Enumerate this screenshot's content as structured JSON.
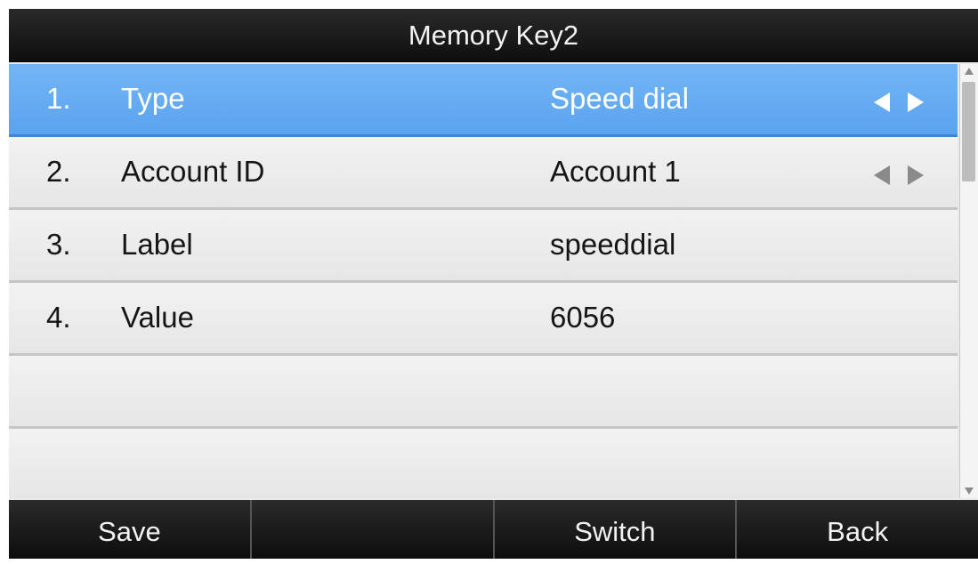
{
  "title": "Memory Key2",
  "rows": [
    {
      "num": "1.",
      "label": "Type",
      "value": "Speed dial",
      "has_arrows": true,
      "selected": true
    },
    {
      "num": "2.",
      "label": "Account ID",
      "value": "Account 1",
      "has_arrows": true,
      "selected": false
    },
    {
      "num": "3.",
      "label": "Label",
      "value": "speeddial",
      "has_arrows": false,
      "selected": false
    },
    {
      "num": "4.",
      "label": "Value",
      "value": "6056",
      "has_arrows": false,
      "selected": false
    }
  ],
  "softkeys": [
    "Save",
    "",
    "Switch",
    "Back"
  ],
  "colors": {
    "selected_row": "#64acf2",
    "bar": "#1a1a1a"
  }
}
